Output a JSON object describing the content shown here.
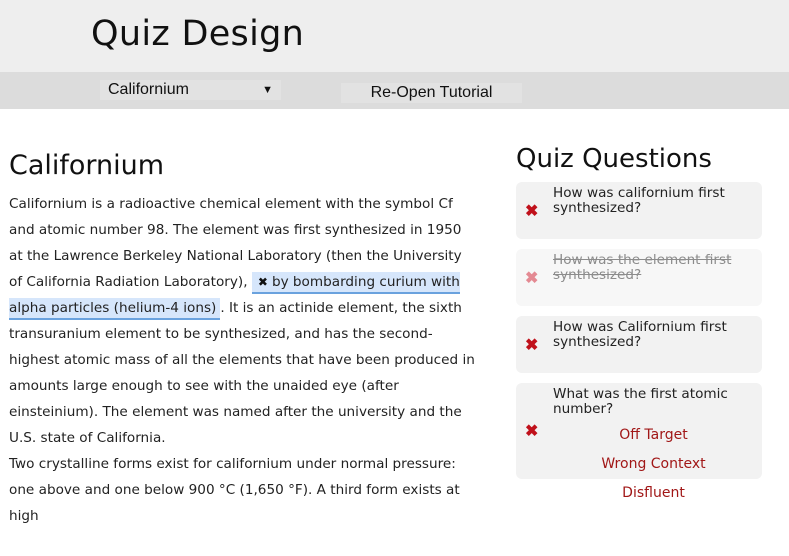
{
  "header": {
    "title": "Quiz Design"
  },
  "toolbar": {
    "document_select": {
      "selected": "Californium"
    },
    "reopen_label": "Re-Open Tutorial"
  },
  "document": {
    "title": "Californium",
    "text_before": "Californium is a radioactive chemical element with the symbol Cf and atomic number 98. The element was first synthesized in 1950 at the Lawrence Berkeley National Laboratory (then the University of California Radiation Laboratory), ",
    "highlight": "by bombarding curium with alpha particles (helium-4 ions)",
    "text_after": ". It is an actinide element, the sixth transuranium element to be synthesized, and has the second-highest atomic mass of all the elements that have been produced in amounts large enough to see with the unaided eye (after einsteinium). The element was named after the university and the U.S. state of California.",
    "paragraph2": "Two crystalline forms exist for californium under normal pressure: one above and one below 900 °C (1,650 °F). A third form exists at high"
  },
  "quiz": {
    "title": "Quiz Questions",
    "questions": [
      {
        "text": "How was californium first synthesized?",
        "state": "active",
        "icon": "x-icon"
      },
      {
        "text": "How was the element first synthesized?",
        "state": "struck",
        "icon": "x-icon"
      },
      {
        "text": "How was Californium first synthesized?",
        "state": "active",
        "icon": "x-icon"
      },
      {
        "text": "What was the first atomic number?",
        "state": "active",
        "icon": "x-icon",
        "tags": [
          "Off Target",
          "Wrong Context",
          "Disfluent"
        ]
      }
    ]
  },
  "colors": {
    "reject": "#c0111b",
    "highlight_bg": "#d6e6fb",
    "highlight_border": "#6aa2de",
    "tag_text": "#a11717"
  }
}
